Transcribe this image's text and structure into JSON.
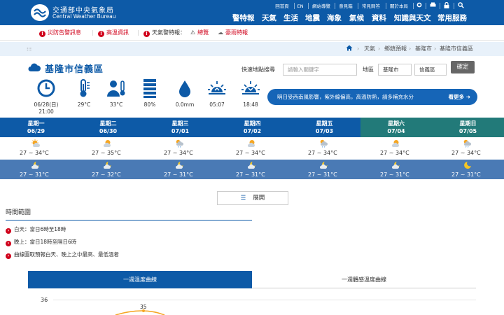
{
  "header": {
    "logo_title": "交通部中央氣象局",
    "logo_subtitle": "Central Weather Bureau",
    "util": [
      "回首頁",
      "EN",
      "網站導覽",
      "意見箱",
      "常見問答",
      "關於本局"
    ],
    "util_icons": [
      "gear-icon",
      "print-icon",
      "lock-icon",
      "search-icon"
    ],
    "nav": [
      "警特報",
      "天氣",
      "生活",
      "地震",
      "海象",
      "氣候",
      "資料",
      "知識與天文",
      "常用服務"
    ]
  },
  "alerts": {
    "disaster": "災防告警訊息",
    "heat": "高溫資訊",
    "warn_label": "天氣警特報：",
    "overview": "總覽",
    "rain": "豪雨特報"
  },
  "breadcrumb": {
    "menu": ":::",
    "items": [
      "天氣",
      "鄉鎮預報",
      "基隆市",
      "基隆市信義區"
    ]
  },
  "location": {
    "title": "基隆市信義區"
  },
  "current": [
    {
      "icon": "clock-icon",
      "value": "06/28(日)\n21:00"
    },
    {
      "icon": "thermometer-icon",
      "value": "29°C"
    },
    {
      "icon": "feels-like-icon",
      "value": "33°C"
    },
    {
      "icon": "humidity-bars-icon",
      "value": "80%"
    },
    {
      "icon": "rain-drop-icon",
      "value": "0.0mm"
    },
    {
      "icon": "sunrise-icon",
      "value": "05:07"
    },
    {
      "icon": "sunset-icon",
      "value": "18:48"
    }
  ],
  "search": {
    "label": "快速地點搜尋",
    "placeholder": "請輸入關鍵字",
    "area_label": "地區",
    "city": "基隆市",
    "district": "信義區",
    "confirm": "確定"
  },
  "banner": {
    "text": "明日受西南風影響，紫外線偏高，高溫防熱，請多補充水分",
    "more": "看更多"
  },
  "days": [
    {
      "name": "星期一",
      "date": "06/29",
      "day_temp": "27 ~ 34°C",
      "night_temp": "27 ~ 31°C"
    },
    {
      "name": "星期二",
      "date": "06/30",
      "day_temp": "27 ~ 35°C",
      "night_temp": "27 ~ 32°C"
    },
    {
      "name": "星期三",
      "date": "07/01",
      "day_temp": "27 ~ 34°C",
      "night_temp": "27 ~ 31°C"
    },
    {
      "name": "星期四",
      "date": "07/02",
      "day_temp": "27 ~ 34°C",
      "night_temp": "27 ~ 31°C"
    },
    {
      "name": "星期五",
      "date": "07/03",
      "day_temp": "27 ~ 34°C",
      "night_temp": "27 ~ 31°C"
    },
    {
      "name": "星期六",
      "date": "07/04",
      "day_temp": "27 ~ 34°C",
      "night_temp": "27 ~ 31°C"
    },
    {
      "name": "星期日",
      "date": "07/05",
      "day_temp": "27 ~ 34°C",
      "night_temp": "27 ~ 31°C"
    }
  ],
  "colors": {
    "primary": "#0d5aa7",
    "weekday": "#0d5aa7",
    "weekend": "#227a79",
    "night": "#4a7ab5",
    "alert": "#d0021b"
  },
  "expand": {
    "label": "展開"
  },
  "time_range": {
    "title": "時間範圍",
    "notes": [
      "白天：當日6時至18時",
      "晚上：當日18時至隔日6時",
      "曲線圖取預報白天、晚上之中最高、最低溫者"
    ]
  },
  "tabs": [
    "一週溫度曲線",
    "一週體感溫度曲線"
  ],
  "chart": {
    "y_tick": "36",
    "point_label": "35"
  }
}
